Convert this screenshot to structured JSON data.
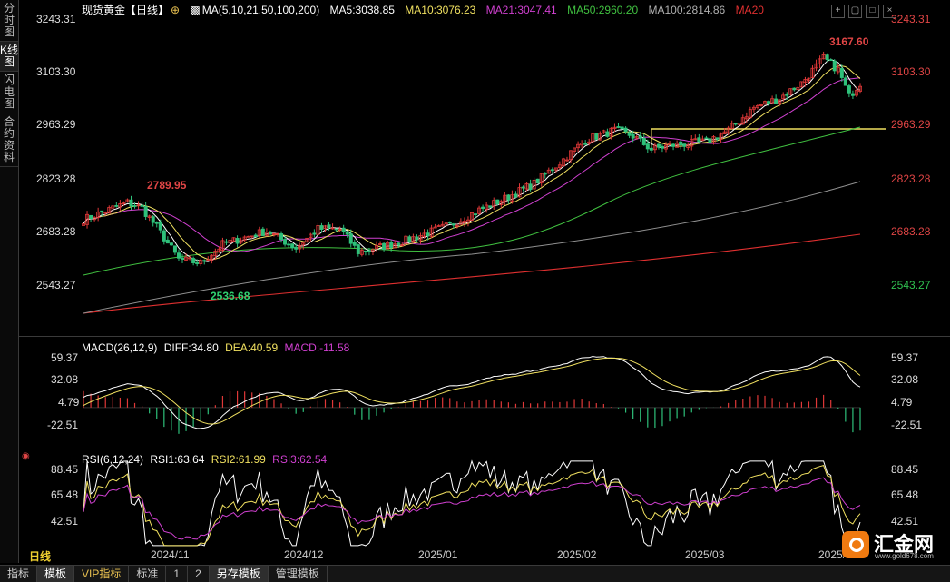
{
  "sidebar": {
    "tabs": [
      "分时图",
      "K线图",
      "闪电图",
      "合约资料"
    ],
    "active": 1
  },
  "header": {
    "title": "现货黄金【日线】",
    "ma_label": "MA(5,10,21,50,100,200)",
    "ma5": "MA5:3038.85",
    "ma10": "MA10:3076.23",
    "ma21": "MA21:3047.41",
    "ma50": "MA50:2960.20",
    "ma100": "MA100:2814.86",
    "ma20": "MA20"
  },
  "main_axis": [
    "3243.31",
    "3103.30",
    "2963.29",
    "2823.28",
    "2683.28",
    "2543.27"
  ],
  "annotations": {
    "high": "3167.60",
    "high_left": "2789.95",
    "low": "2536.68"
  },
  "macd": {
    "label": "MACD(26,12,9)",
    "diff": "DIFF:34.80",
    "dea": "DEA:40.59",
    "macd": "MACD:-11.58",
    "axis": [
      "59.37",
      "32.08",
      "4.79",
      "-22.51"
    ]
  },
  "rsi": {
    "label": "RSI(6,12,24)",
    "rsi1": "RSI1:63.64",
    "rsi2": "RSI2:61.99",
    "rsi3": "RSI3:62.54",
    "axis": [
      "88.45",
      "65.48",
      "42.51"
    ]
  },
  "xaxis": {
    "period": "日线",
    "labels": [
      "2024/11",
      "2024/12",
      "2025/01",
      "2025/02",
      "2025/03",
      "2025/"
    ]
  },
  "toolbar": [
    "指标",
    "模板",
    "VIP指标",
    "标准",
    "1",
    "2",
    "另存模板",
    "管理模板"
  ],
  "logo": {
    "name": "汇金网",
    "url": "www.gold678.com"
  },
  "colors": {
    "up": "#e03838",
    "down": "#2ec07a",
    "ma5": "#ffffff",
    "ma10": "#f0e060",
    "ma21": "#d040d0",
    "ma50": "#40c040",
    "ma100": "#a0a0a0",
    "ma200": "#e03030"
  }
}
